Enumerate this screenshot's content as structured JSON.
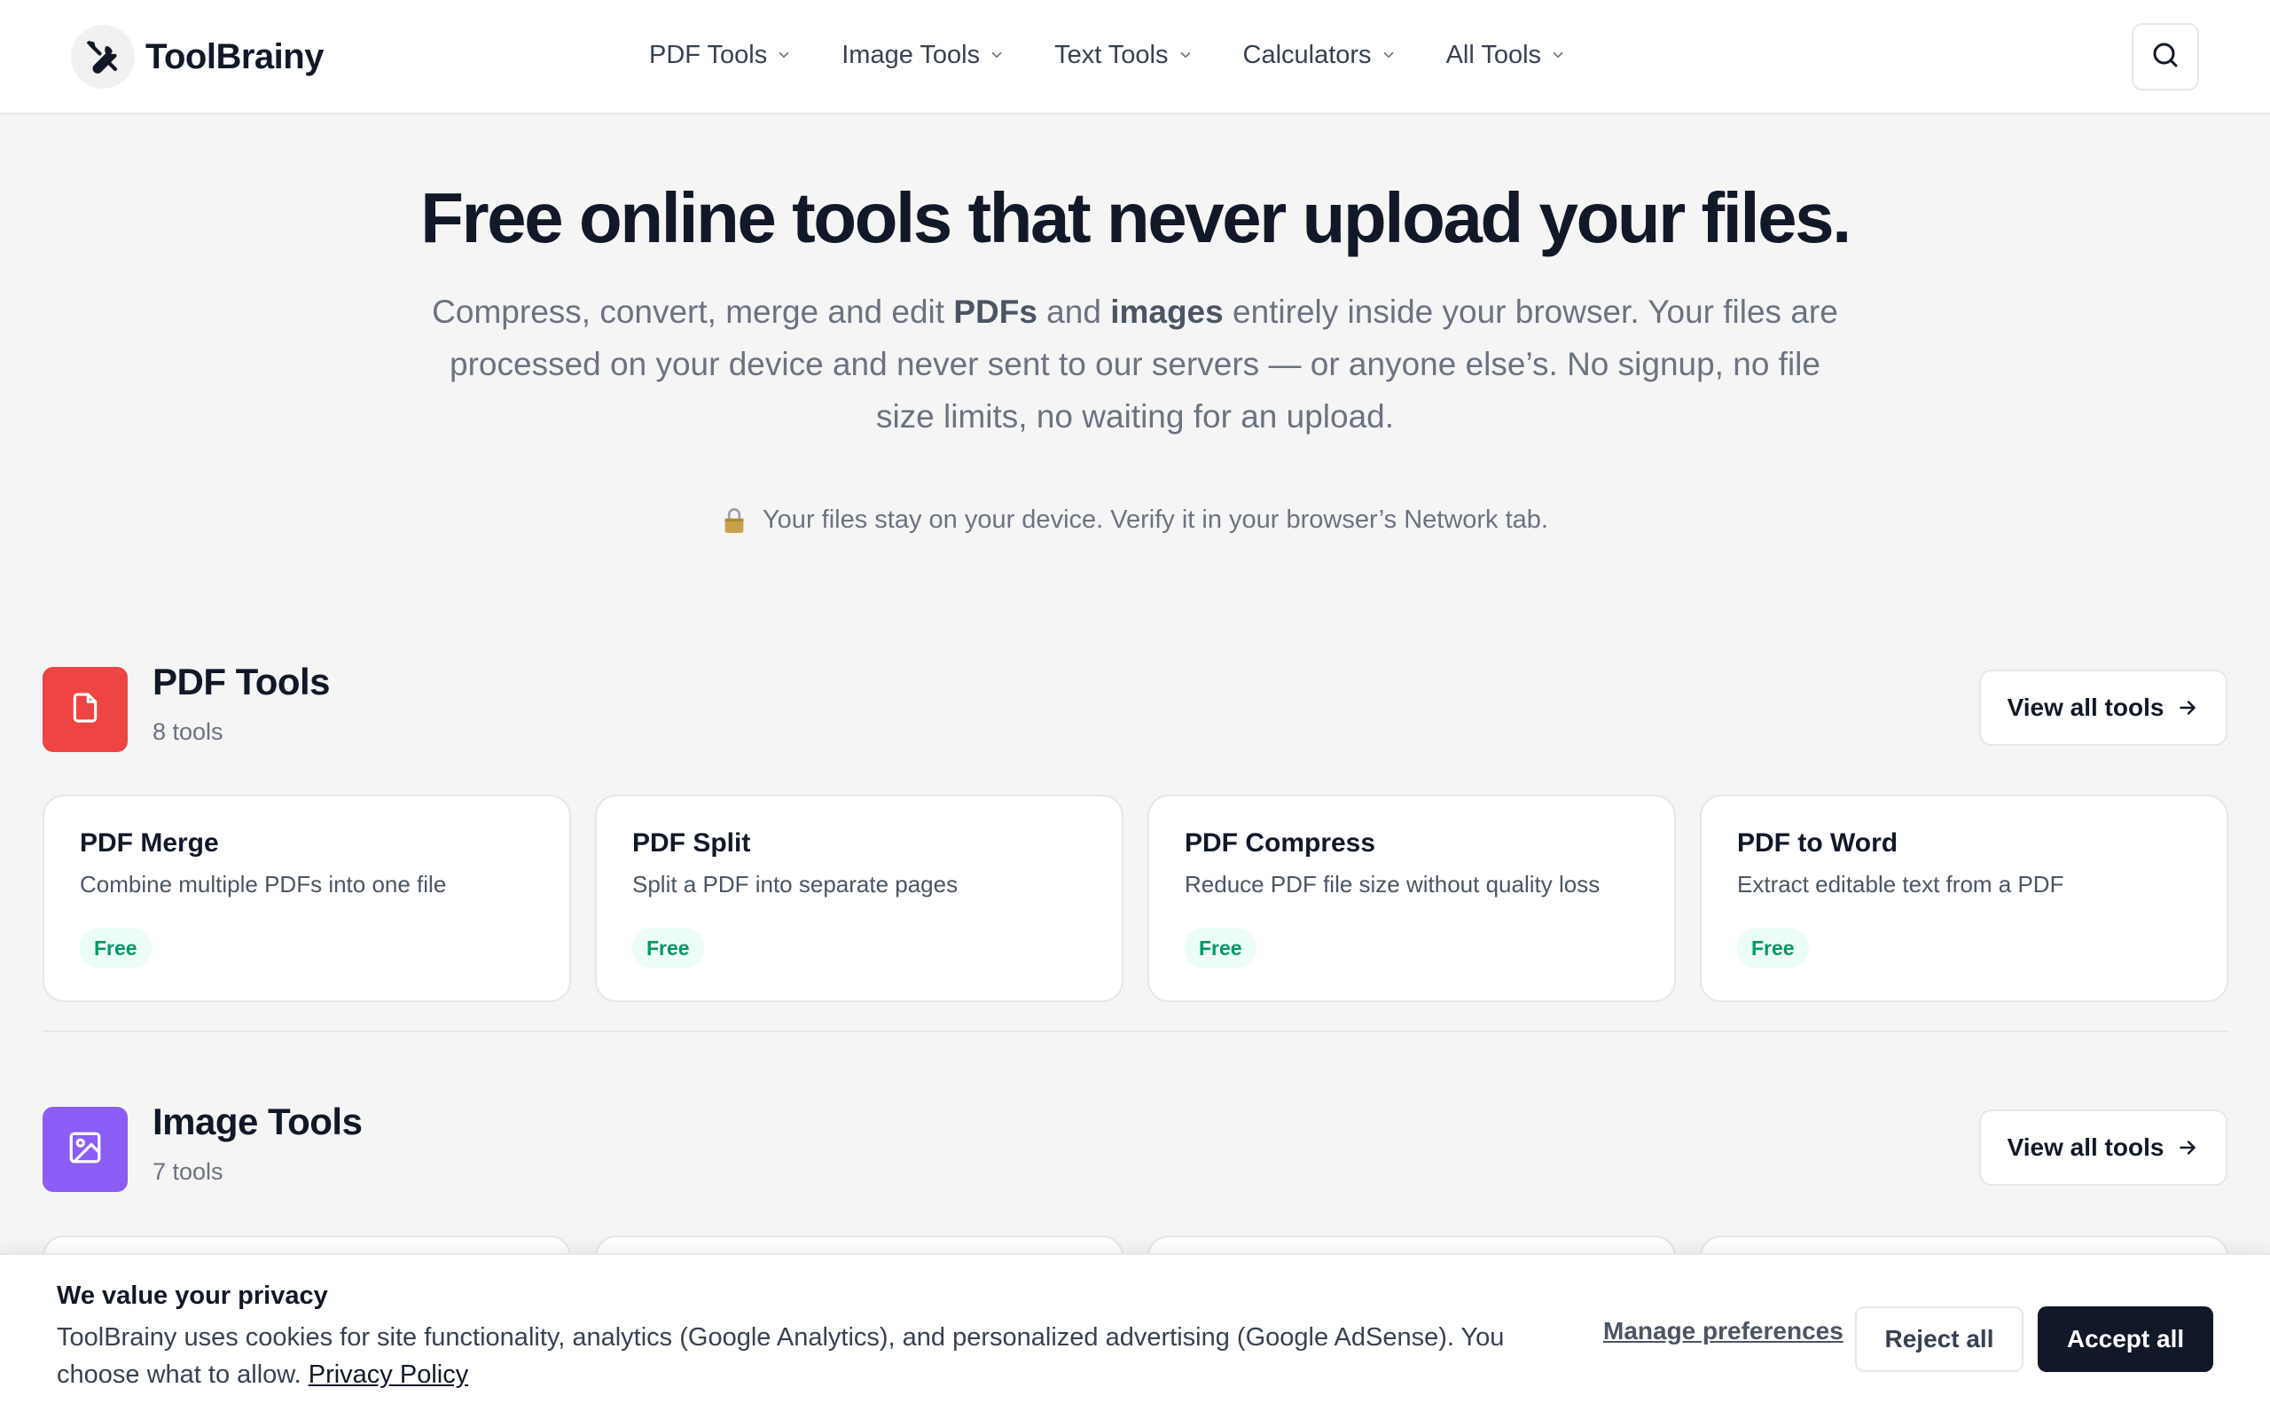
{
  "brand": {
    "name": "ToolBrainy",
    "icon": "wrench-screwdriver-icon"
  },
  "nav": {
    "items": [
      {
        "label": "PDF Tools"
      },
      {
        "label": "Image Tools"
      },
      {
        "label": "Text Tools"
      },
      {
        "label": "Calculators"
      },
      {
        "label": "All Tools"
      }
    ],
    "search_icon": "search-icon"
  },
  "hero": {
    "title": "Free online tools that never upload your files.",
    "desc_1": "Compress, convert, merge and edit ",
    "desc_bold_1": "PDFs",
    "desc_2": " and ",
    "desc_bold_2": "images",
    "desc_3": " entirely inside your browser. Your files are processed on your device and never sent to our servers — or anyone else’s. No signup, no file size limits, no waiting for an upload.",
    "trust": "Your files stay on your device. Verify it in your browser’s Network tab."
  },
  "sections": [
    {
      "title": "PDF Tools",
      "count": "8 tools",
      "color": "#ef4444",
      "view_all": "View all tools",
      "cards": [
        {
          "title": "PDF Merge",
          "desc": "Combine multiple PDFs into one file",
          "badge": "Free"
        },
        {
          "title": "PDF Split",
          "desc": "Split a PDF into separate pages",
          "badge": "Free"
        },
        {
          "title": "PDF Compress",
          "desc": "Reduce PDF file size without quality loss",
          "badge": "Free"
        },
        {
          "title": "PDF to Word",
          "desc": "Extract editable text from a PDF",
          "badge": "Free"
        }
      ]
    },
    {
      "title": "Image Tools",
      "count": "7 tools",
      "color": "#8b5cf6",
      "view_all": "View all tools"
    }
  ],
  "cookie": {
    "title": "We value your privacy",
    "text": "ToolBrainy uses cookies for site functionality, analytics (Google Analytics), and personalized advertising (Google AdSense). You choose what to allow. ",
    "policy_link": "Privacy Policy",
    "manage": "Manage preferences",
    "reject": "Reject all",
    "accept": "Accept all"
  },
  "colors": {
    "badge_green": "#059669",
    "dark": "#111827"
  }
}
